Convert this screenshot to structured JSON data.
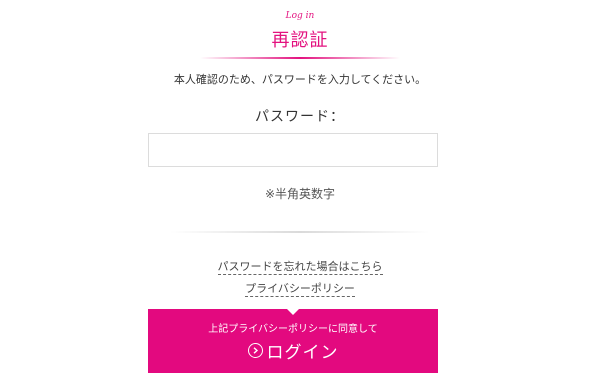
{
  "header": {
    "eyebrow": "Log in",
    "title": "再認証"
  },
  "intro_text": "本人確認のため、パスワードを入力してください。",
  "password": {
    "label": "パスワード：",
    "value": "",
    "hint": "※半角英数字"
  },
  "links": {
    "forgot_password": "パスワードを忘れた場合はこちら",
    "privacy_policy": "プライバシーポリシー"
  },
  "login_button": {
    "agree_text": "上記プライバシーポリシーに同意して",
    "label": "ログイン"
  },
  "colors": {
    "accent": "#e3097f",
    "border": "#dcdcdc",
    "text": "#333333"
  },
  "icons": {
    "login": "circle-arrow-right-icon"
  }
}
